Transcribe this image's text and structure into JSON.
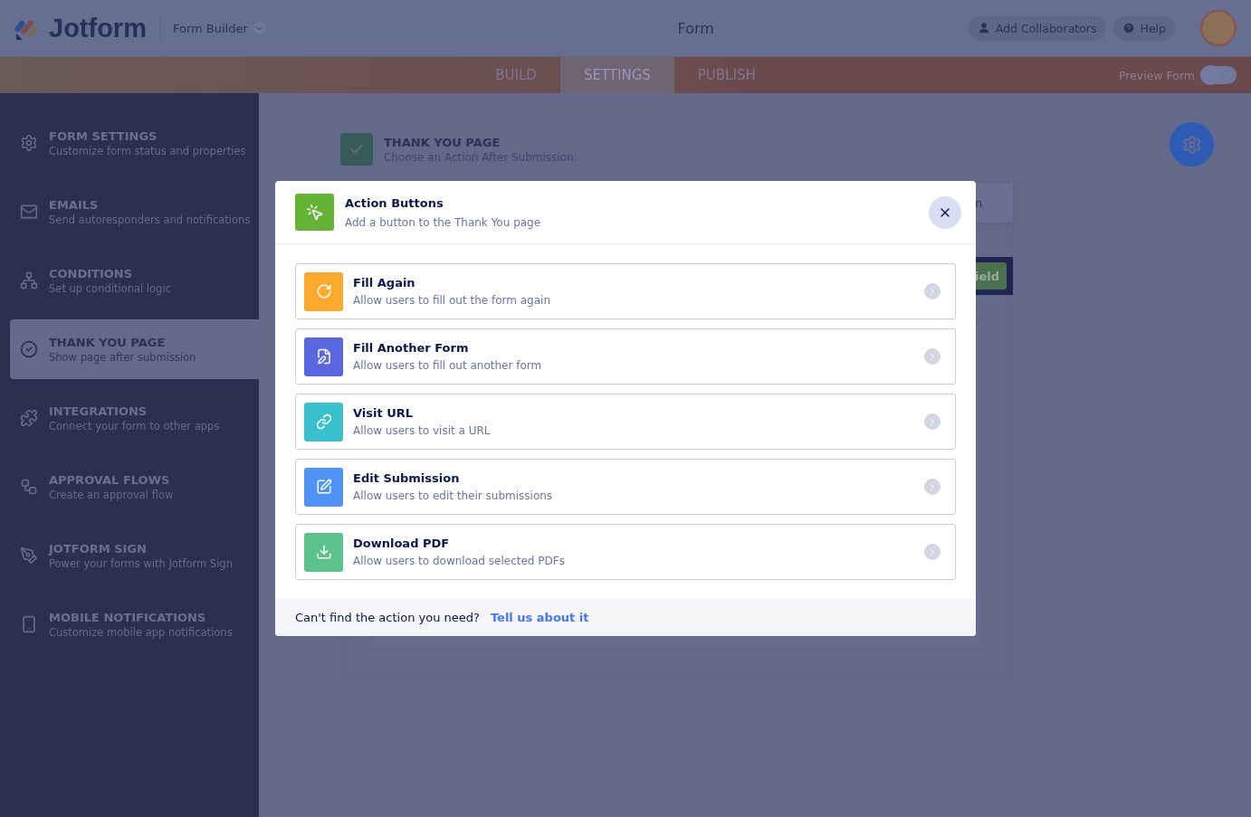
{
  "header": {
    "logo": "Jotform",
    "product": "Form Builder",
    "title": "Form",
    "buttons": [
      {
        "label": "Add Collaborators",
        "kind": "collaborators"
      },
      {
        "label": "Help",
        "kind": "help"
      }
    ]
  },
  "tabs": [
    {
      "label": "BUILD",
      "selected": false
    },
    {
      "label": "SETTINGS",
      "selected": true
    },
    {
      "label": "PUBLISH",
      "selected": false
    }
  ],
  "preview": {
    "label": "Preview Form",
    "on": false
  },
  "sidebar": {
    "items": [
      {
        "title": "FORM SETTINGS",
        "subtitle": "Customize form status and properties",
        "selected": false
      },
      {
        "title": "EMAILS",
        "subtitle": "Send autoresponders and notifications",
        "selected": false
      },
      {
        "title": "CONDITIONS",
        "subtitle": "Set up conditional logic",
        "selected": false
      },
      {
        "title": "THANK YOU PAGE",
        "subtitle": "Show page after submission",
        "selected": true
      },
      {
        "title": "INTEGRATIONS",
        "subtitle": "Connect your form to other apps",
        "selected": false
      },
      {
        "title": "APPROVAL FLOWS",
        "subtitle": "Create an approval flow",
        "selected": false
      },
      {
        "title": "JOTFORM SIGN",
        "subtitle": "Power your forms with Jotform Sign",
        "selected": false
      },
      {
        "title": "MOBILE NOTIFICATIONS",
        "subtitle": "Customize mobile app notifications",
        "selected": false
      }
    ]
  },
  "page": {
    "title": "THANK YOU PAGE",
    "subtitle": "Choose an Action After Submission:",
    "card_fragment": "n",
    "button_fragment": "ield"
  },
  "modal": {
    "title": "Action Buttons",
    "subtitle": "Add a button to the Thank You page",
    "actions": [
      {
        "title": "Fill Again",
        "description": "Allow users to fill out the form again",
        "color": "#fbaa2d"
      },
      {
        "title": "Fill Another Form",
        "description": "Allow users to fill out another form",
        "color": "#5a67e0"
      },
      {
        "title": "Visit URL",
        "description": "Allow users to visit a URL",
        "color": "#38c1cd"
      },
      {
        "title": "Edit Submission",
        "description": "Allow users to edit their submissions",
        "color": "#4f94f5"
      },
      {
        "title": "Download PDF",
        "description": "Allow users to download selected PDFs",
        "color": "#5ac28a"
      }
    ],
    "footer": {
      "text": "Can't find the action you need?",
      "link": "Tell us about it"
    }
  }
}
